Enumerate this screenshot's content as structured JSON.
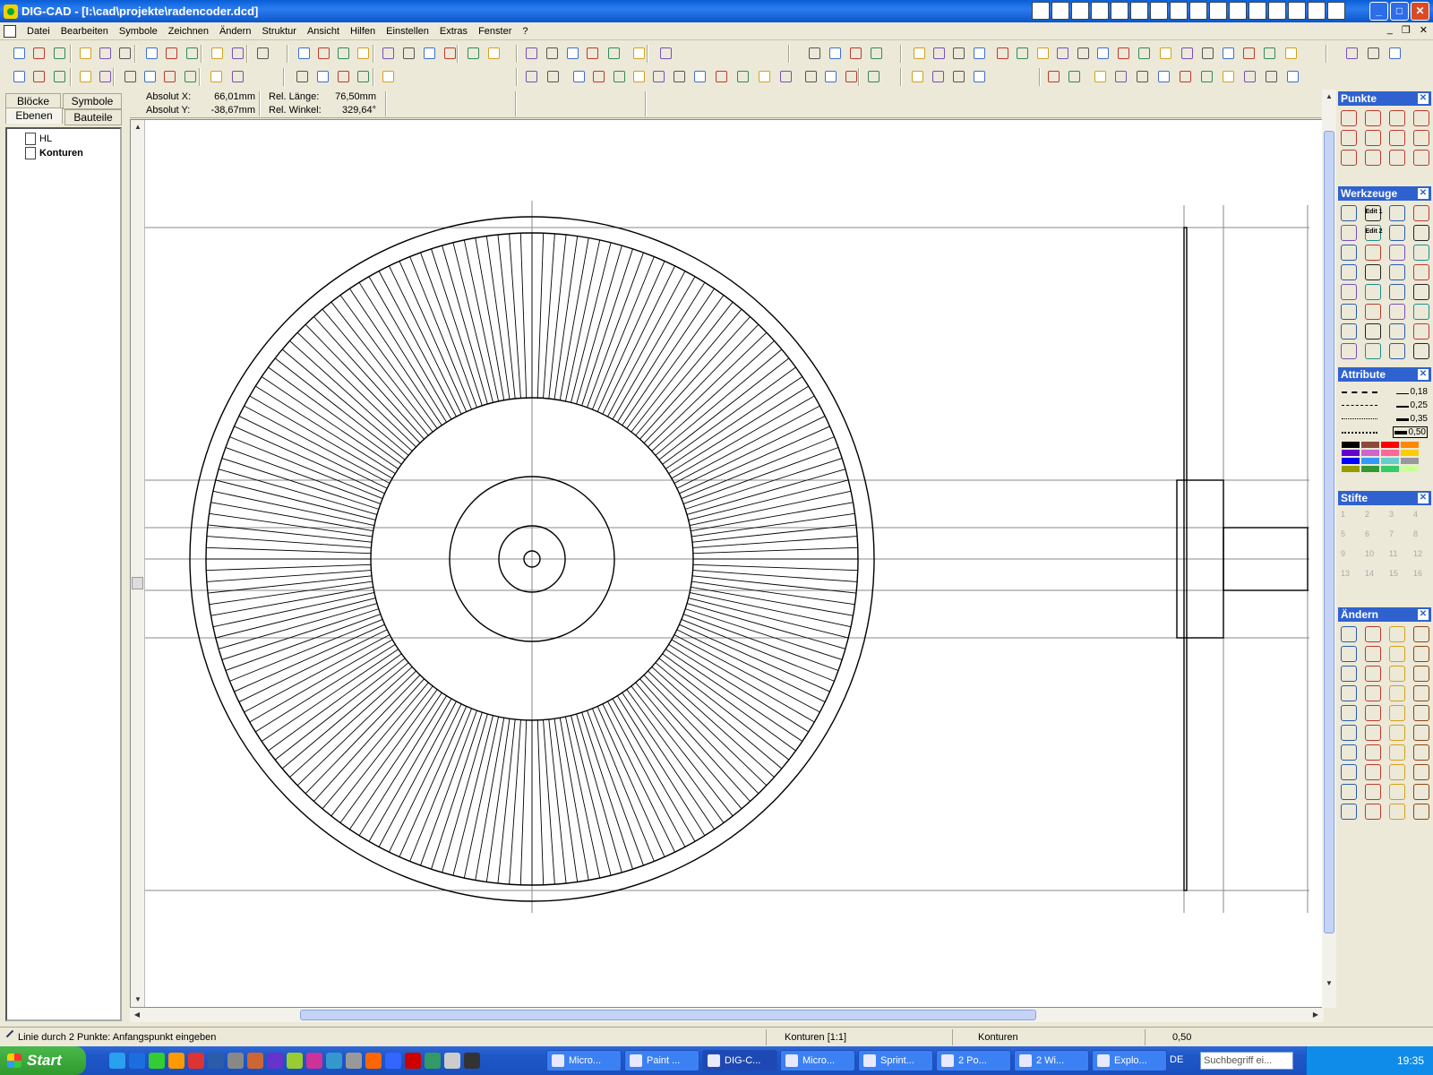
{
  "window": {
    "title": "DIG-CAD - [I:\\cad\\projekte\\radencoder.dcd]",
    "controls": {
      "minimize": "_",
      "maximize": "□",
      "close": "✕"
    }
  },
  "menu": [
    "Datei",
    "Bearbeiten",
    "Symbole",
    "Zeichnen",
    "Ändern",
    "Struktur",
    "Ansicht",
    "Hilfen",
    "Einstellen",
    "Extras",
    "Fenster",
    "?"
  ],
  "mdi_controls": {
    "minimize": "_",
    "restore": "❐",
    "close": "✕"
  },
  "left_panel": {
    "tabs": [
      "Blöcke",
      "Symbole",
      "Ebenen",
      "Bauteile"
    ],
    "active_tab": "Ebenen",
    "layers": [
      "HL",
      "Konturen"
    ],
    "active_layer": "Konturen"
  },
  "coords": {
    "abs_x_label": "Absolut X:",
    "abs_x_value": "66,01mm",
    "abs_y_label": "Absolut Y:",
    "abs_y_value": "-38,67mm",
    "rel_len_label": "Rel. Länge:",
    "rel_len_value": "76,50mm",
    "rel_angle_label": "Rel. Winkel:",
    "rel_angle_value": "329,64°"
  },
  "palettes": {
    "punkte": "Punkte",
    "werkzeuge": "Werkzeuge",
    "werkzeuge_edit1": "Edit 1",
    "werkzeuge_edit2": "Edit 2",
    "attribute": "Attribute",
    "line_widths": [
      "0,18",
      "0,25",
      "0,35",
      "0,50"
    ],
    "colors": [
      "#000000",
      "#8b4a3a",
      "#ff0000",
      "#ff8800",
      "#6600cc",
      "#cc66cc",
      "#ff6699",
      "#ffcc00",
      "#0000ff",
      "#3399ff",
      "#66cccc",
      "#999999",
      "#999900",
      "#339933",
      "#33cc66",
      "#ccff99"
    ],
    "stifte": "Stifte",
    "stifte_numbers": [
      "1",
      "2",
      "3",
      "4",
      "5",
      "6",
      "7",
      "8",
      "9",
      "10",
      "11",
      "12",
      "13",
      "14",
      "15",
      "16"
    ],
    "aendern": "Ändern"
  },
  "status": {
    "prompt": "Linie durch 2 Punkte: Anfangspunkt eingeben",
    "layer": "Konturen [1:1]",
    "component": "Konturen",
    "line_width": "0,50"
  },
  "taskbar": {
    "start": "Start",
    "buttons": [
      "Micro...",
      "Paint ...",
      "DIG-C...",
      "Micro...",
      "Sprint...",
      "2 Po...",
      "2 Wi...",
      "Explo..."
    ],
    "active_button": "DIG-C...",
    "lang": "DE",
    "search_placeholder": "Suchbegriff ei...",
    "clock": "19:35"
  },
  "drawing": {
    "tick_count": 180,
    "accent": "#000000"
  }
}
